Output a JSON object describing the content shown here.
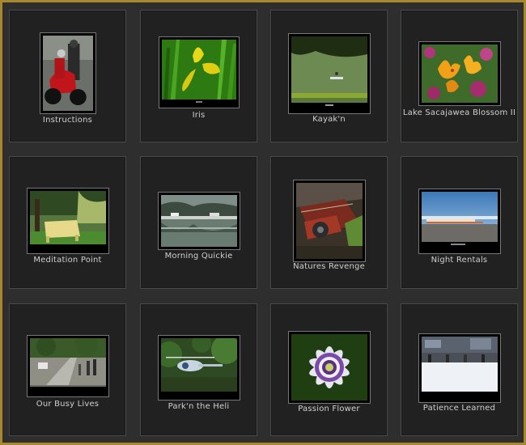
{
  "gallery": {
    "items": [
      {
        "title": "Instructions"
      },
      {
        "title": "Iris"
      },
      {
        "title": "Kayak'n"
      },
      {
        "title": "Lake Sacajawea Blossom II"
      },
      {
        "title": "Meditation Point"
      },
      {
        "title": "Morning Quickie"
      },
      {
        "title": "Natures Revenge"
      },
      {
        "title": "Night Rentals"
      },
      {
        "title": "Our Busy Lives"
      },
      {
        "title": "Park'n the Heli"
      },
      {
        "title": "Passion Flower"
      },
      {
        "title": "Patience Learned"
      }
    ]
  },
  "colors": {
    "border_gold": "#a8872e",
    "cell_bg": "#212121",
    "caption": "#cfcfcf"
  }
}
